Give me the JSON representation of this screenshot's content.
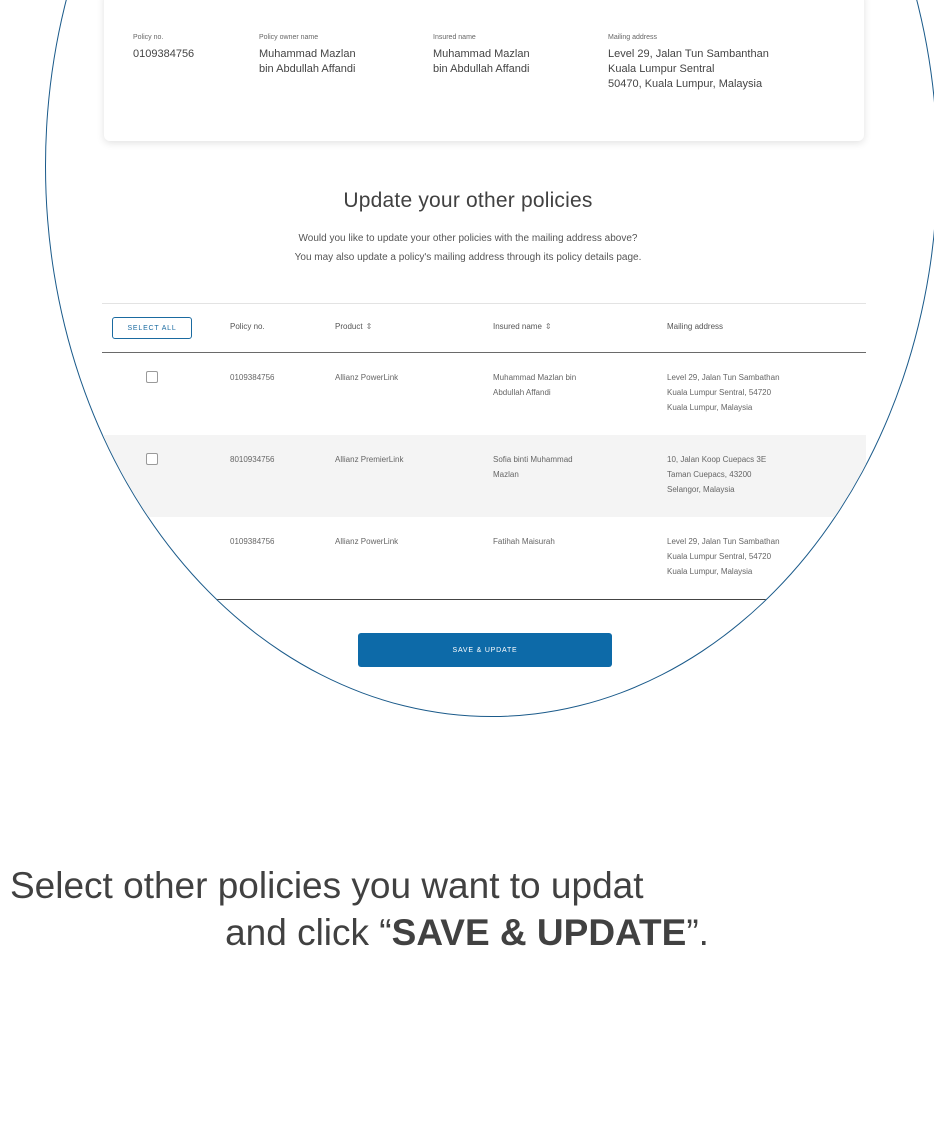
{
  "policy_info": {
    "policy_no_label": "Policy no.",
    "policy_no": "0109384756",
    "owner_label": "Policy owner name",
    "owner": "Muhammad Mazlan\nbin Abdullah Affandi",
    "insured_label": "Insured name",
    "insured": "Muhammad Mazlan\nbin Abdullah Affandi",
    "mailing_label": "Mailing address",
    "mailing": "Level 29, Jalan Tun Sambanthan\nKuala Lumpur Sentral\n50470, Kuala Lumpur, Malaysia"
  },
  "section": {
    "title": "Update your other policies",
    "desc_line1": "Would you like to update your other policies with the mailing address above?",
    "desc_line2": "You may also update a policy's mailing address through its policy details page."
  },
  "table": {
    "select_all": "SELECT ALL",
    "headers": {
      "policy_no": "Policy no.",
      "product": "Product",
      "insured": "Insured name",
      "mailing": "Mailing address"
    },
    "rows": [
      {
        "policy_no": "0109384756",
        "product": "Allianz PowerLink",
        "insured": "Muhammad Mazlan bin\nAbdullah Affandi",
        "mailing": "Level 29, Jalan Tun Sambathan\nKuala Lumpur Sentral, 54720\nKuala Lumpur, Malaysia"
      },
      {
        "policy_no": "8010934756",
        "product": "Allianz PremierLink",
        "insured": "Sofia binti Muhammad\nMazlan",
        "mailing": "10, Jalan Koop Cuepacs 3E\nTaman Cuepacs, 43200\nSelangor, Malaysia"
      },
      {
        "policy_no": "0109384756",
        "product": "Allianz PowerLink",
        "insured": "Fatihah Maisurah",
        "mailing": "Level 29, Jalan Tun Sambathan\nKuala Lumpur Sentral, 54720\nKuala Lumpur, Malaysia"
      }
    ]
  },
  "save_button": "SAVE & UPDATE",
  "caption": {
    "line1": "Select other policies you want to updat",
    "line2_pre": "and click “",
    "line2_bold": "SAVE & UPDATE",
    "line2_post": "”."
  },
  "colors": {
    "accent": "#0d6aa8",
    "lens_border": "#1a5a8a",
    "row_alt": "#f4f4f4"
  },
  "icons": {
    "sort": "sort-icon"
  }
}
